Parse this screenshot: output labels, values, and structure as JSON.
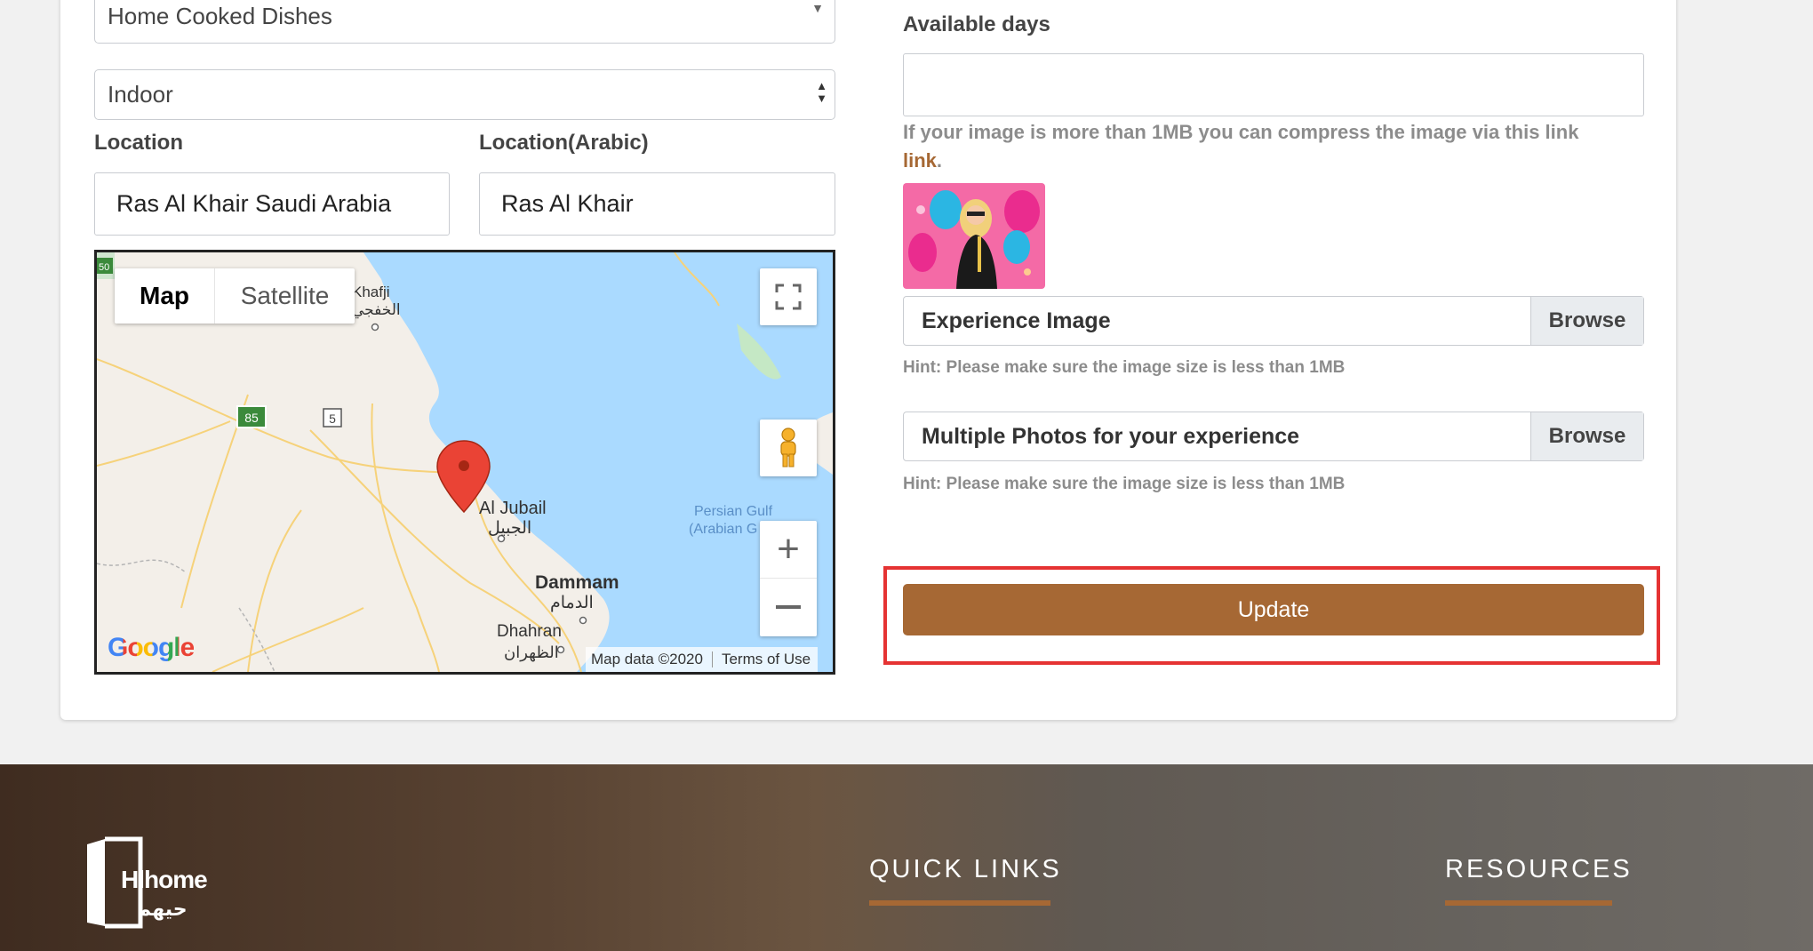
{
  "form": {
    "category_value": "Home Cooked Dishes",
    "setting_value": "Indoor",
    "location_label": "Location",
    "location_value": "Ras Al Khair Saudi Arabia",
    "location_ar_label": "Location(Arabic)",
    "location_ar_value": "Ras Al Khair",
    "available_days_label": "Available days",
    "available_days_value": "",
    "compress_hint": "If your image is more than 1MB you can compress the image via this link",
    "compress_link": "link",
    "compress_period": ".",
    "experience_image_label": "Experience Image",
    "multiple_photos_label": "Multiple Photos for your experience",
    "browse_label": "Browse",
    "size_hint": "Hint: Please make sure the image size is less than 1MB",
    "update_label": "Update"
  },
  "map": {
    "map_tab": "Map",
    "satellite_tab": "Satellite",
    "places": {
      "khafji_en": "Khafji",
      "khafji_ar": "الخفجي",
      "jubail_en": "Al Jubail",
      "jubail_ar": "الجبيل",
      "dammam_en": "Dammam",
      "dammam_ar": "الدمام",
      "dhahran_en": "Dhahran",
      "dhahran_ar": "الظهران",
      "gulf_1": "Persian Gulf",
      "gulf_2": "(Arabian G"
    },
    "road_85": "85",
    "road_5": "5",
    "road_50": "50",
    "google": "Google",
    "map_data": "Map data ©2020",
    "terms": "Terms of Use"
  },
  "footer": {
    "logo_text": "Hlhome",
    "logo_ar": "حيهم",
    "quick_links": "QUICK LINKS",
    "resources": "RESOURCES"
  },
  "colors": {
    "accent": "#a66834",
    "highlight": "#e53333",
    "water": "#aadaff"
  }
}
